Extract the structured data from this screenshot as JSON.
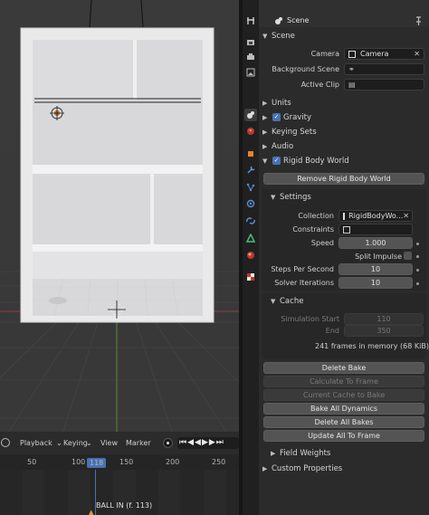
{
  "timeline": {
    "menu": [
      "Playback",
      "Keying",
      "View",
      "Marker"
    ],
    "current_frame": "118",
    "ruler_ticks": [
      "50",
      "100",
      "150",
      "200",
      "250"
    ],
    "marker_label": "BALL IN (f. 113)"
  },
  "properties": {
    "header_title": "Scene",
    "scene_panel": {
      "title": "Scene",
      "camera_label": "Camera",
      "camera_value": "Camera",
      "background_label": "Background Scene",
      "active_clip_label": "Active Clip"
    },
    "units_label": "Units",
    "gravity_label": "Gravity",
    "gravity_checked": true,
    "keying_sets_label": "Keying Sets",
    "audio_label": "Audio",
    "rigid_body": {
      "title": "Rigid Body World",
      "enabled": true,
      "remove_button": "Remove Rigid Body World",
      "settings_title": "Settings",
      "collection_label": "Collection",
      "collection_value": "RigidBodyWo...",
      "constraints_label": "Constraints",
      "speed_label": "Speed",
      "speed_value": "1.000",
      "split_impulse_label": "Split Impulse",
      "steps_label": "Steps Per Second",
      "steps_value": "10",
      "solver_label": "Solver Iterations",
      "solver_value": "10"
    },
    "cache": {
      "title": "Cache",
      "sim_start_label": "Simulation Start",
      "sim_start_value": "110",
      "end_label": "End",
      "end_value": "350",
      "memory_text": "241 frames in memory (68 KiB)."
    },
    "buttons": {
      "delete_bake": "Delete Bake",
      "calculate_to_frame": "Calculate To Frame",
      "current_cache_to_bake": "Current Cache to Bake",
      "bake_all_dynamics": "Bake All Dynamics",
      "delete_all_bakes": "Delete All Bakes",
      "update_all_to_frame": "Update All To Frame"
    },
    "field_weights_label": "Field Weights",
    "custom_properties_label": "Custom Properties"
  },
  "colors": {
    "accent": "#4772b3",
    "panel": "#2b2b2b",
    "field": "#1d1d1d"
  }
}
